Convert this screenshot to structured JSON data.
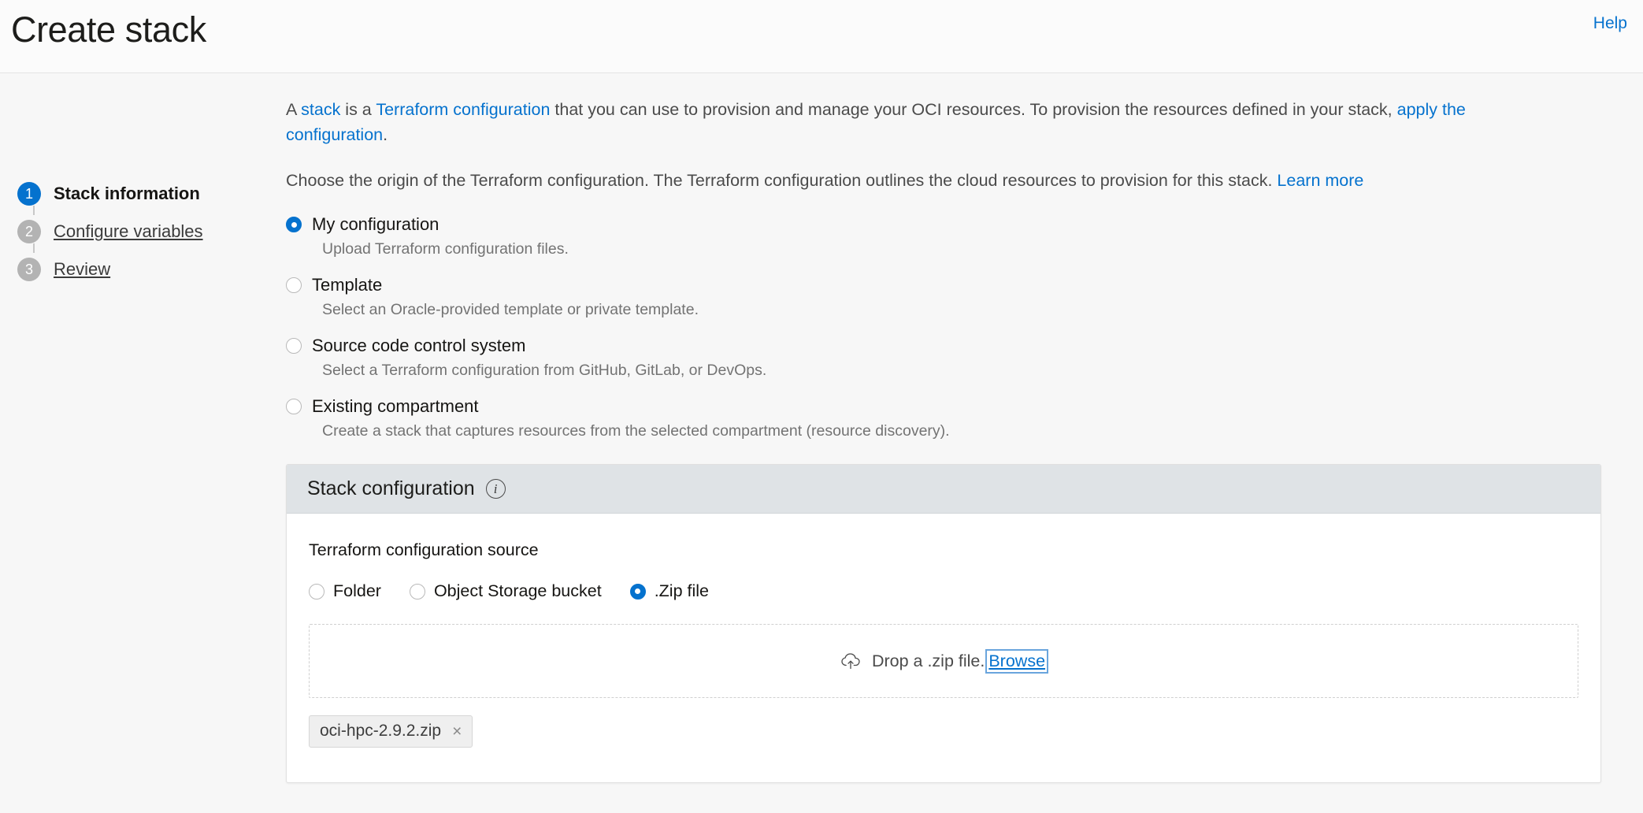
{
  "header": {
    "title": "Create stack",
    "help_label": "Help"
  },
  "steps": [
    {
      "number": "1",
      "label": "Stack information",
      "active": true
    },
    {
      "number": "2",
      "label": "Configure variables",
      "active": false
    },
    {
      "number": "3",
      "label": "Review",
      "active": false
    }
  ],
  "intro": {
    "p1_a": "A ",
    "p1_link1": "stack",
    "p1_b": " is a ",
    "p1_link2": "Terraform configuration",
    "p1_c": " that you can use to provision and manage your OCI resources. To provision the resources defined in your stack, ",
    "p1_link3": "apply the configuration",
    "p1_d": ".",
    "p2_a": "Choose the origin of the Terraform configuration. The Terraform configuration outlines the cloud resources to provision for this stack. ",
    "p2_link": "Learn more"
  },
  "origin_options": [
    {
      "label": "My configuration",
      "description": "Upload Terraform configuration files.",
      "selected": true
    },
    {
      "label": "Template",
      "description": "Select an Oracle-provided template or private template.",
      "selected": false
    },
    {
      "label": "Source code control system",
      "description": "Select a Terraform configuration from GitHub, GitLab, or DevOps.",
      "selected": false
    },
    {
      "label": "Existing compartment",
      "description": "Create a stack that captures resources from the selected compartment (resource discovery).",
      "selected": false
    }
  ],
  "panel": {
    "title": "Stack configuration",
    "info_icon": "info-icon",
    "source_label": "Terraform configuration source",
    "source_options": [
      {
        "label": "Folder",
        "selected": false
      },
      {
        "label": "Object Storage bucket",
        "selected": false
      },
      {
        "label": ".Zip file",
        "selected": true
      }
    ],
    "dropzone": {
      "icon": "cloud-upload-icon",
      "text": "Drop a .zip file.",
      "browse_label": "Browse"
    },
    "file": {
      "name": "oci-hpc-2.9.2.zip",
      "remove_icon": "×"
    }
  },
  "colors": {
    "accent": "#0572ce",
    "panel_header_bg": "#dfe3e6",
    "page_bg": "#f7f7f7",
    "step_inactive": "#b3b3b3",
    "focus_ring": "#6aa5dd"
  }
}
